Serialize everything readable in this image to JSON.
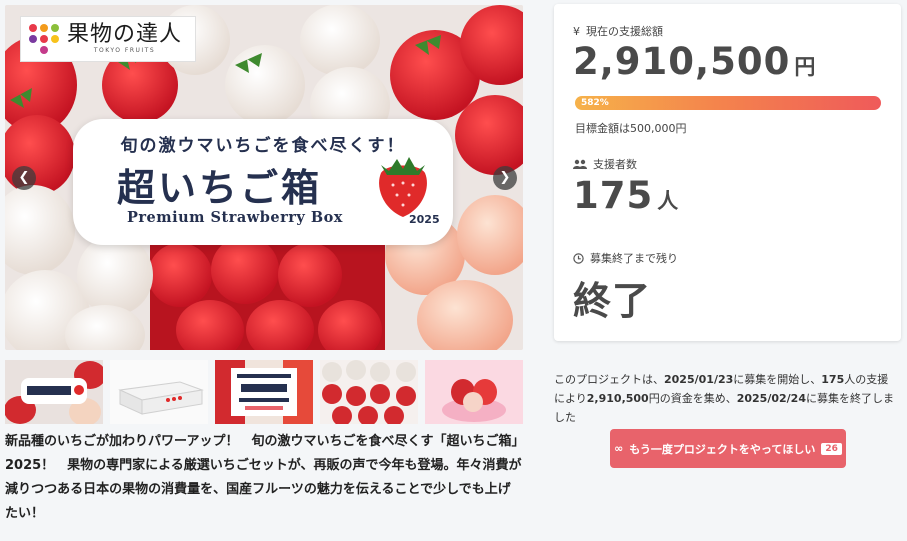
{
  "logo": {
    "name_jp": "果物の達人",
    "name_en": "TOKYO FRUITS"
  },
  "hero": {
    "catchphrase": "旬の激ウマいちごを食べ尽くす！",
    "title": "超いちご箱",
    "subtitle": "Premium Strawberry Box",
    "year": "2025",
    "prev_icon": "chevron-left-icon",
    "next_icon": "chevron-right-icon"
  },
  "thumbnails": [
    "thumb-1",
    "thumb-2",
    "thumb-3",
    "thumb-4",
    "thumb-5"
  ],
  "description": "新品種のいちごが加わりパワーアップ！　旬の激ウマいちごを食べ尽くす「超いちご箱」2025！　果物の専門家による厳選いちごセットが、再販の声で今年も登場。年々消費が減りつつある日本の果物の消費量を、国産フルーツの魅力を伝えることで少しでも上げたい！",
  "stats": {
    "total_label": "現在の支援総額",
    "total_value": "2,910,500",
    "total_unit": "円",
    "progress_percent": 582,
    "progress_text": "582%",
    "goal_text": "目標金額は500,000円",
    "supporters_label": "支援者数",
    "supporters_value": "175",
    "supporters_unit": "人",
    "remaining_label": "募集終了まで残り",
    "remaining_value": "終了"
  },
  "summary": {
    "p1": "このプロジェクトは、",
    "start_date": "2025/01/23",
    "p2": "に募集を開始し、",
    "supporters": "175",
    "p3": "人の支援により",
    "amount": "2,910,500",
    "p4": "円の資金を集め、",
    "end_date": "2025/02/24",
    "p5": "に募集を終了しました"
  },
  "request_button": {
    "label": "もう一度プロジェクトをやってほしい",
    "count": "26",
    "icon": "infinity-icon"
  },
  "colors": {
    "accent": "#e8636b",
    "navy": "#25304f",
    "progress_start": "#f6b24a",
    "progress_end": "#ef5a5a"
  }
}
